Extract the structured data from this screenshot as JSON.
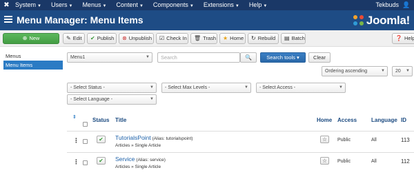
{
  "navbar": {
    "logo_icon": "joomla-x-icon",
    "menus": [
      {
        "label": "System"
      },
      {
        "label": "Users"
      },
      {
        "label": "Menus"
      },
      {
        "label": "Content"
      },
      {
        "label": "Components"
      },
      {
        "label": "Extensions"
      },
      {
        "label": "Help"
      }
    ],
    "site_name": "Tekbuds",
    "user_icon": "user-icon"
  },
  "header": {
    "title": "Menu Manager: Menu Items",
    "brand": "Joomla!"
  },
  "toolbar": {
    "new": "New",
    "edit": "Edit",
    "publish": "Publish",
    "unpublish": "Unpublish",
    "check_in": "Check In",
    "trash": "Trash",
    "home": "Home",
    "rebuild": "Rebuild",
    "batch": "Batch",
    "help": "Help"
  },
  "sidebar": {
    "items": [
      {
        "label": "Menus",
        "active": false
      },
      {
        "label": "Menu Items",
        "active": true
      }
    ]
  },
  "filters": {
    "menu_select": "Menu1",
    "search_placeholder": "Search",
    "search_tools": "Search tools",
    "clear": "Clear",
    "ordering": "Ordering ascending",
    "limit": "20",
    "status": "- Select Status -",
    "max_levels": "- Select Max Levels -",
    "access": "- Select Access -",
    "language": "- Select Language -"
  },
  "table": {
    "headers": {
      "status": "Status",
      "title": "Title",
      "home": "Home",
      "access": "Access",
      "language": "Language",
      "id": "ID"
    },
    "rows": [
      {
        "title": "TutorialsPoint",
        "alias": "(Alias: tutorialspoint)",
        "type": "Articles » Single Article",
        "access": "Public",
        "language": "All",
        "id": "113"
      },
      {
        "title": "Service",
        "alias": "(Alias: service)",
        "type": "Articles » Single Article",
        "access": "Public",
        "language": "All",
        "id": "112"
      }
    ]
  },
  "colors": {
    "navbar": "#1a3867",
    "header": "#1e4c85",
    "new_button": "#5cb85c",
    "primary": "#2b7bc4",
    "link": "#1a5fa8"
  }
}
